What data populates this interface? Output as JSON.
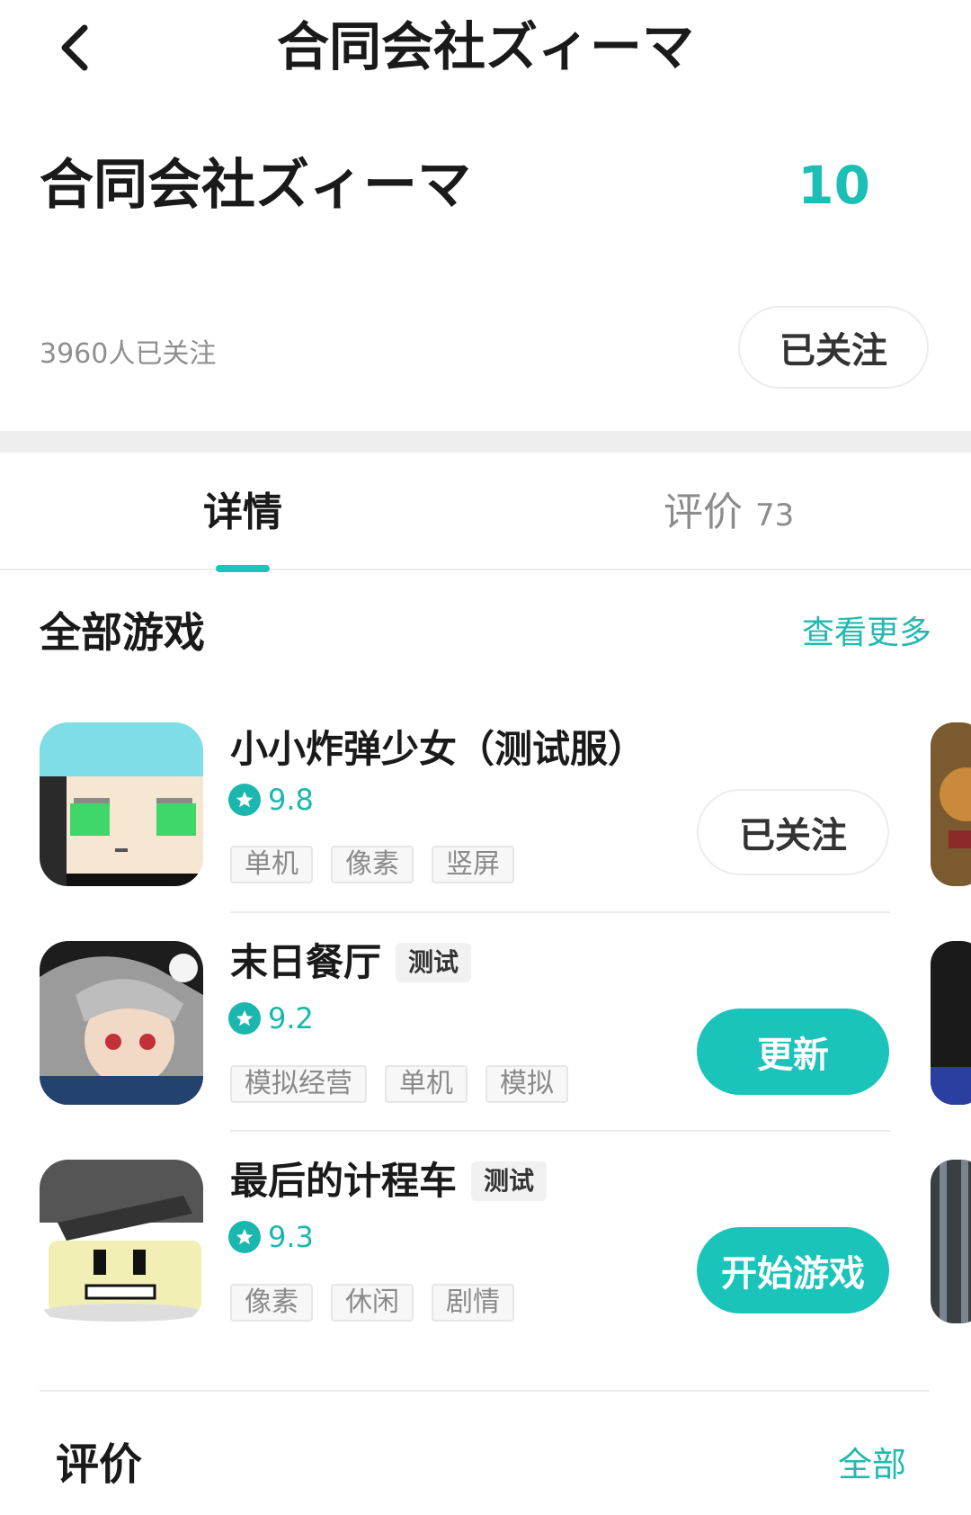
{
  "nav": {
    "back_icon": "chevron-left-icon",
    "title": "合同会社ズィーマ"
  },
  "developer": {
    "name": "合同会社ズィーマ",
    "game_count": "10",
    "followers": "3960人已关注",
    "follow_label": "已关注"
  },
  "tabs": [
    {
      "label": "详情",
      "count": "",
      "active": true
    },
    {
      "label": "评价",
      "count": "73",
      "active": false
    }
  ],
  "all_games": {
    "title": "全部游戏",
    "more_label": "查看更多",
    "games": [
      {
        "name": "小小炸弹少女（测试服）",
        "badge": "",
        "rating": "9.8",
        "tags": [
          "单机",
          "像素",
          "竖屏"
        ],
        "action": "已关注"
      },
      {
        "name": "末日餐厅",
        "badge": "测试",
        "rating": "9.2",
        "tags": [
          "模拟经营",
          "单机",
          "模拟"
        ],
        "action": "更新"
      },
      {
        "name": "最后的计程车",
        "badge": "测试",
        "rating": "9.3",
        "tags": [
          "像素",
          "休闲",
          "剧情"
        ],
        "action": "开始游戏"
      }
    ]
  },
  "reviews_section": {
    "title": "评价",
    "all_label": "全部"
  },
  "colors": {
    "accent": "#1bc4ba",
    "rating": "#1bb7ae",
    "separator": "#eeeeee"
  }
}
